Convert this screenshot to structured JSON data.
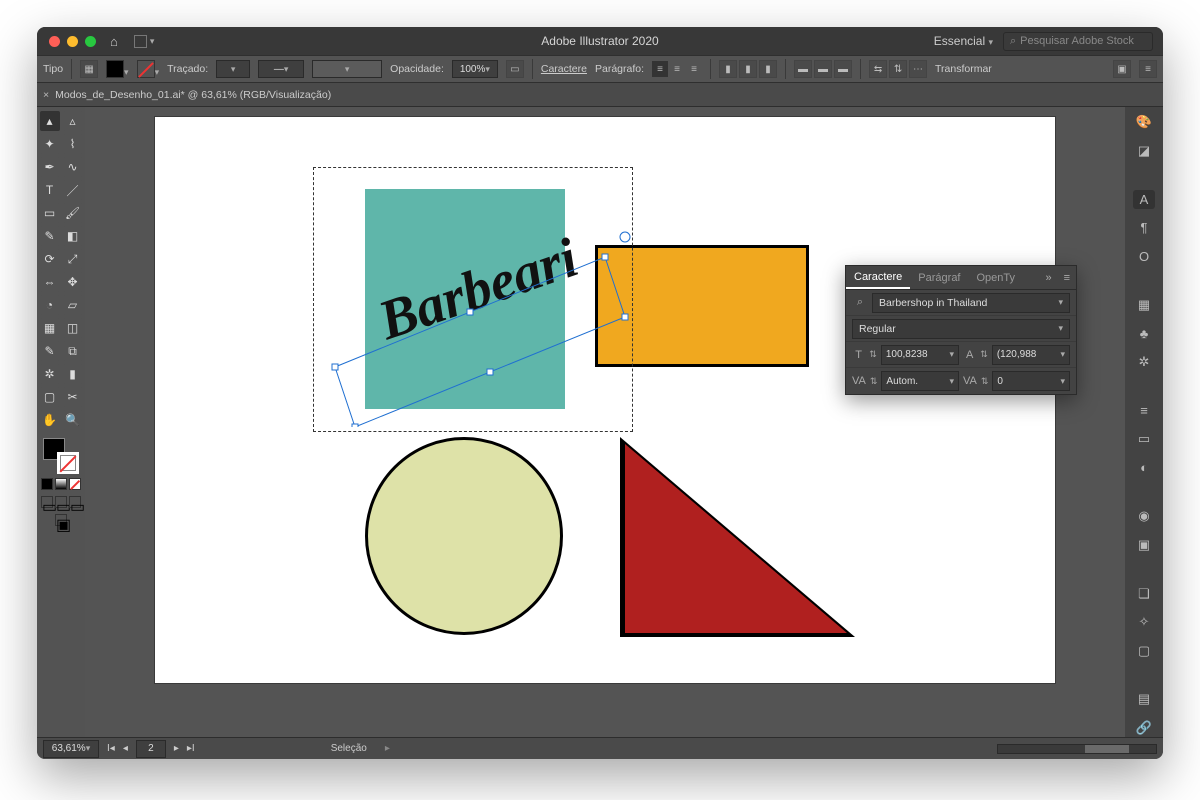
{
  "app": {
    "title": "Adobe Illustrator 2020",
    "workspace_label": "Essencial",
    "search_placeholder": "Pesquisar Adobe Stock"
  },
  "options_bar": {
    "mode_label": "Tipo",
    "stroke_label": "Traçado:",
    "stroke_value": "",
    "opacity_label": "Opacidade:",
    "opacity_value": "100%",
    "character_label": "Caractere",
    "paragraph_label": "Parágrafo:",
    "transform_label": "Transformar"
  },
  "document_tab": {
    "close_glyph": "×",
    "label": "Modos_de_Desenho_01.ai* @ 63,61% (RGB/Visualização)"
  },
  "canvas": {
    "text_content": "Barbeari"
  },
  "character_panel": {
    "tabs": {
      "character": "Caractere",
      "paragraph": "Parágraf",
      "opentype": "OpenTy"
    },
    "font_family": "Barbershop in Thailand",
    "font_style": "Regular",
    "font_size": "100,8238",
    "leading": "(120,988",
    "kerning": "Autom.",
    "tracking": "0"
  },
  "status": {
    "zoom": "63,61%",
    "page": "2",
    "mode": "Seleção"
  }
}
